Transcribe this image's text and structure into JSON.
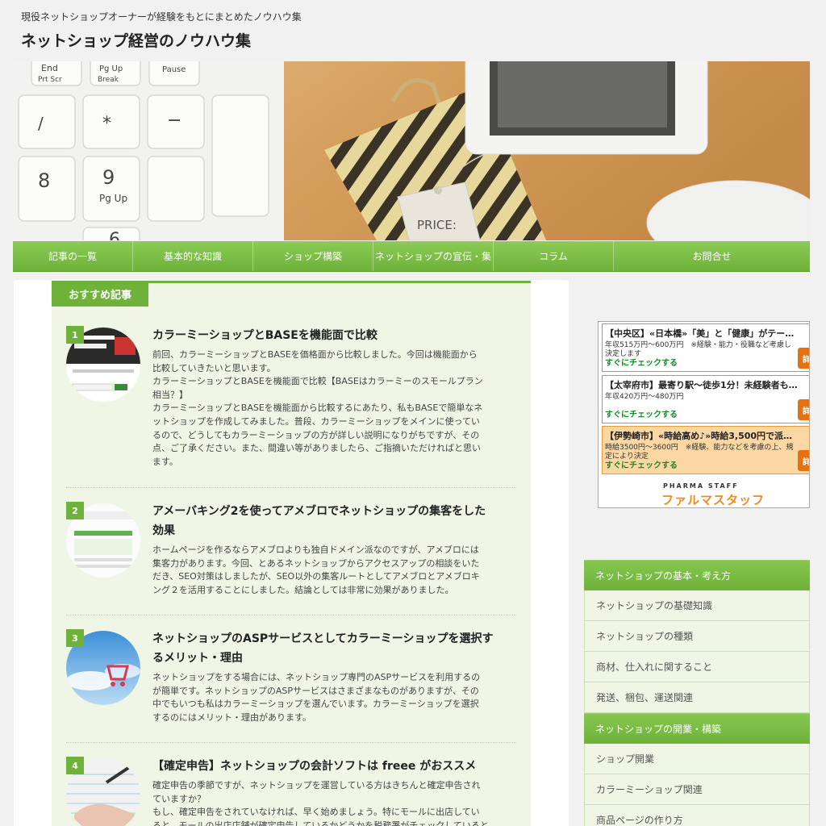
{
  "header": {
    "tagline": "現役ネットショップオーナーが経験をもとにまとめたノウハウ集",
    "site_title": "ネットショップ経営のノウハウ集"
  },
  "hero": {
    "keys": [
      "End",
      "Prt Scr",
      "Pg Up",
      "Break",
      "Pause",
      "/",
      "*",
      "−",
      "8",
      "9",
      "Pg Up",
      "6"
    ],
    "tag_text": "PRICE:"
  },
  "nav": {
    "items": [
      {
        "label": "記事の一覧"
      },
      {
        "label": "基本的な知識"
      },
      {
        "label": "ショップ構築"
      },
      {
        "label": "ネットショップの宣伝・集"
      },
      {
        "label": "コラム"
      },
      {
        "label": "お問合せ"
      }
    ]
  },
  "recommended": {
    "label": "おすすめ記事",
    "articles": [
      {
        "rank": "1",
        "title": "カラーミーショップとBASEを機能面で比較",
        "lines": [
          "前回、カラーミーショップとBASEを価格面から比較しました。今回は機能面から",
          "比較していきたいと思います。",
          "カラーミーショップとBASEを機能面で比較【BASEはカラーミーのスモールプラン",
          "相当？】",
          "カラーミーショップとBASEを機能面から比較するにあたり、私もBASEで簡単なネ",
          "ットショップを作成してみました。普段、カラーミーショップをメインに使ってい",
          "るので、どうしてもカラーミーショップの方が詳しい説明になりがちですが、その",
          "点、ご了承ください。また、間違い等がありましたら、ご指摘いただければと思い",
          "ます。"
        ]
      },
      {
        "rank": "2",
        "title_lines": [
          "アメーバキング2を使ってアメブロでネットショップの集客をした",
          "効果"
        ],
        "lines": [
          "ホームページを作るならアメブロよりも独自ドメイン派なのですが、アメブロには",
          "集客力があります。今回、とあるネットショップからアクセスアップの相談をいた",
          "だき、SEO対策はしましたが、SEO以外の集客ルートとしてアメブロとアメブロキ",
          "ング２を活用することにしました。結論としては非常に効果がありました。"
        ]
      },
      {
        "rank": "3",
        "title_lines": [
          "ネットショップのASPサービスとしてカラーミーショップを選択す",
          "るメリット・理由"
        ],
        "lines": [
          "ネットショップをする場合には、ネットショップ専門のASPサービスを利用するの",
          "が簡単です。ネットショップのASPサービスはさまざまなものがありますが、その",
          "中でもいつも私はカラーミーショップを選んでいます。カラーミーショップを選択",
          "するのにはメリット・理由があります。"
        ]
      },
      {
        "rank": "4",
        "title": "【確定申告】ネットショップの会計ソフトは freee がおススメ",
        "lines": [
          "確定申告の季節ですが、ネットショップを運営している方はきちんと確定申告され",
          "ていますか？",
          "もし、確定申告をされていなければ、早く始めましょう。特にモールに出店してい",
          "ると、モールの出店店舗が確定申告しているかどうかを税務署がチェックしていると"
        ]
      }
    ]
  },
  "ad": {
    "items": [
      {
        "title": "【中央区】«日本橋»「美」と「健康」がテー…",
        "desc": "年収515万円～600万円　※経験・能力・役職など考慮し決定します",
        "check": "すぐにチェックする",
        "button": "詳"
      },
      {
        "title": "【太宰府市】最寄り駅～徒歩1分！未経験者も…",
        "desc": "年収420万円～480万円",
        "check": "すぐにチェックする",
        "button": "詳"
      },
      {
        "title": "【伊勢崎市】«時給高め♪»時給3,500円で派…",
        "desc": "時給3500円～3600円　※経験、能力などを考慮の上、規定により決定",
        "check": "すぐにチェックする",
        "button": "詳"
      }
    ],
    "logo_small": "PHARMA STAFF",
    "logo": "ファルマスタッフ"
  },
  "sidebar": {
    "groups": [
      {
        "heading": "ネットショップの基本・考え方",
        "items": [
          "ネットショップの基礎知識",
          "ネットショップの種類",
          "商材、仕入れに関すること",
          "発送、梱包、運送関連"
        ]
      },
      {
        "heading": "ネットショップの開業・構築",
        "items": [
          "ショップ開業",
          "カラーミーショップ関連",
          "商品ページの作り方"
        ]
      }
    ]
  },
  "colors": {
    "accent_green": "#6eb23a",
    "nav_green": "#7cbe46",
    "recommend_bg": "#eff6e6",
    "ad_orange": "#e8700f"
  }
}
